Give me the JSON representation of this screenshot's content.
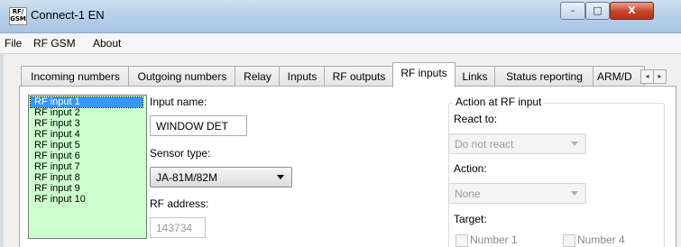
{
  "window": {
    "title": "Connect-1 EN",
    "icon_text": "RF/\nGSM",
    "controls": {
      "minimize": "–",
      "maximize": "□",
      "close": "X"
    }
  },
  "menu": {
    "items": [
      "File",
      "RF GSM",
      "About"
    ]
  },
  "tabs": {
    "items": [
      "Incoming numbers",
      "Outgoing numbers",
      "Relay",
      "Inputs",
      "RF outputs",
      "RF inputs",
      "Links",
      "Status reporting",
      "ARM/D"
    ],
    "active": "RF inputs",
    "scroll_left": "◂",
    "scroll_right": "▸"
  },
  "rf_list": {
    "items": [
      "RF input 1",
      "RF input 2",
      "RF input 3",
      "RF input 4",
      "RF input 5",
      "RF input 6",
      "RF input 7",
      "RF input 8",
      "RF input 9",
      "RF input 10"
    ],
    "selected": "RF input 1"
  },
  "form": {
    "input_name_label": "Input name:",
    "input_name_value": "WINDOW DET",
    "sensor_type_label": "Sensor type:",
    "sensor_type_value": "JA-81M/82M",
    "rf_address_label": "RF address:",
    "rf_address_value": "143734"
  },
  "action_group": {
    "title": "Action at RF input",
    "react_to_label": "React to:",
    "react_to_value": "Do not react",
    "action_label": "Action:",
    "action_value": "None",
    "target_label": "Target:",
    "targets": [
      "Number 1",
      "Number 4"
    ]
  }
}
